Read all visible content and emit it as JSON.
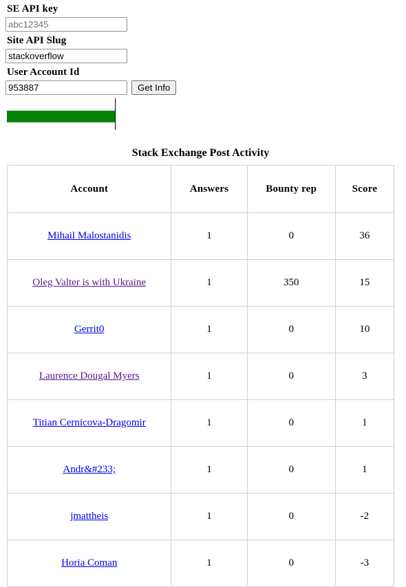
{
  "form": {
    "api_key": {
      "label": "SE API key",
      "value": "",
      "placeholder": "abc12345"
    },
    "site_slug": {
      "label": "Site API Slug",
      "value": "stackoverflow",
      "placeholder": ""
    },
    "account_id": {
      "label": "User Account Id",
      "value": "953887",
      "placeholder": ""
    },
    "submit_label": "Get Info"
  },
  "progress": {
    "value": 100,
    "max": 100,
    "fill_color": "#068306"
  },
  "table": {
    "title": "Stack Exchange Post Activity",
    "columns": [
      "Account",
      "Answers",
      "Bounty rep",
      "Score"
    ],
    "rows": [
      {
        "account": "Mihail Malostanidis",
        "visited": false,
        "answers": "1",
        "bounty": "0",
        "score": "36"
      },
      {
        "account": "Oleg Valter is with Ukraine",
        "visited": true,
        "answers": "1",
        "bounty": "350",
        "score": "15"
      },
      {
        "account": "Gerrit0",
        "visited": false,
        "answers": "1",
        "bounty": "0",
        "score": "10"
      },
      {
        "account": "Laurence Dougal Myers",
        "visited": true,
        "answers": "1",
        "bounty": "0",
        "score": "3"
      },
      {
        "account": "Titian Cernicova-Dragomir",
        "visited": false,
        "answers": "1",
        "bounty": "0",
        "score": "1"
      },
      {
        "account": "Andr&#233;",
        "visited": false,
        "answers": "1",
        "bounty": "0",
        "score": "1"
      },
      {
        "account": "jmattheis",
        "visited": false,
        "answers": "1",
        "bounty": "0",
        "score": "-2"
      },
      {
        "account": "Horia Coman",
        "visited": false,
        "answers": "1",
        "bounty": "0",
        "score": "-3"
      }
    ]
  }
}
